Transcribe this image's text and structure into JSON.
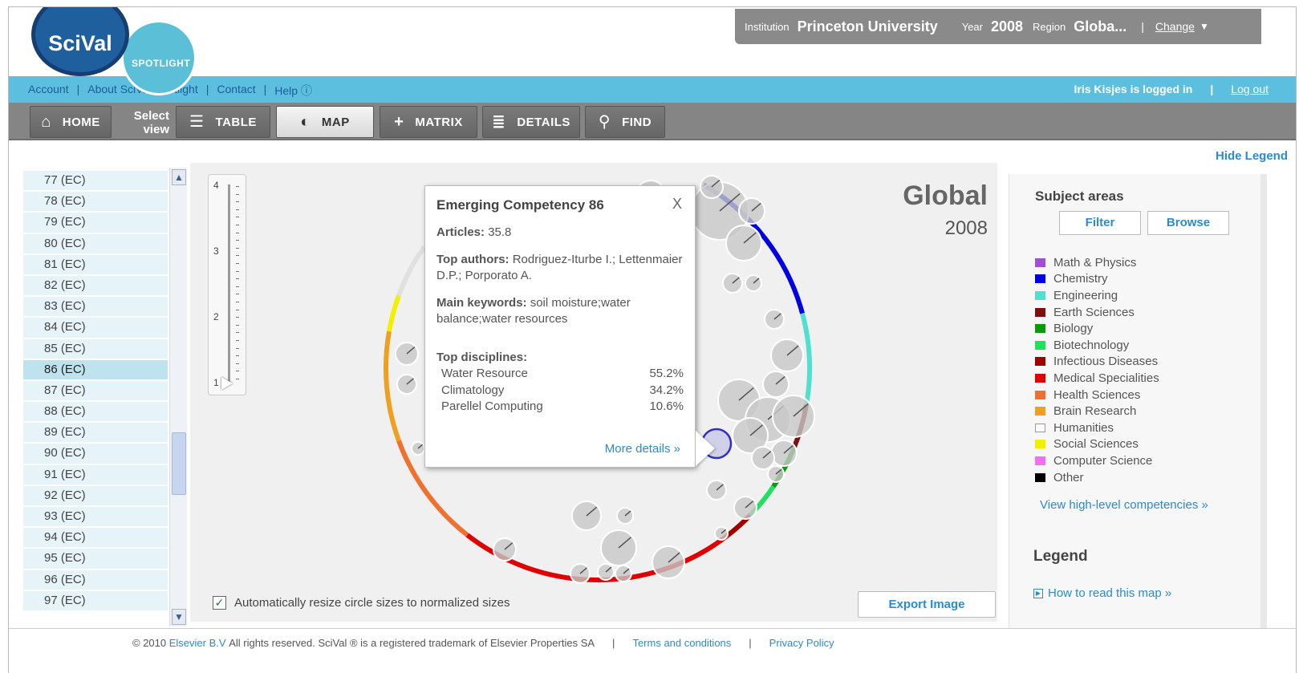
{
  "logo": {
    "main": "SciVal",
    "sub": "SPOTLIGHT"
  },
  "institution_bar": {
    "institution_label": "Institution",
    "institution": "Princeton University",
    "year_label": "Year",
    "year": "2008",
    "region_label": "Region",
    "region": "Globa...",
    "change": "Change"
  },
  "top_links": [
    "Account",
    "About SciVal Spotlight",
    "Contact",
    "Help ⓘ"
  ],
  "user": {
    "status": "Iris Kisjes is logged in",
    "logout": "Log out"
  },
  "toolbar": {
    "home": "HOME",
    "select_view": "Select view",
    "table": "TABLE",
    "map": "MAP",
    "matrix": "MATRIX",
    "details": "DETAILS",
    "find": "FIND"
  },
  "hide_legend": "Hide Legend",
  "list": {
    "items": [
      "77 (EC)",
      "78 (EC)",
      "79 (EC)",
      "80 (EC)",
      "81 (EC)",
      "82 (EC)",
      "83 (EC)",
      "84 (EC)",
      "85 (EC)",
      "86 (EC)",
      "87 (EC)",
      "88 (EC)",
      "89 (EC)",
      "90 (EC)",
      "91 (EC)",
      "92 (EC)",
      "93 (EC)",
      "94 (EC)",
      "95 (EC)",
      "96 (EC)",
      "97 (EC)"
    ],
    "selected": "86 (EC)"
  },
  "slider": {
    "labels": [
      "4",
      "3",
      "2",
      "1"
    ],
    "value": 1
  },
  "map": {
    "title": "Global",
    "year": "2008"
  },
  "popup": {
    "title": "Emerging Competency 86",
    "close": "X",
    "articles_label": "Articles:",
    "articles_value": "35.8",
    "authors_label": "Top authors:",
    "authors_value": "Rodriguez-Iturbe I.; Lettenmaier D.P.; Porporato A.",
    "keywords_label": "Main keywords:",
    "keywords_value": "soil moisture;water balance;water resources",
    "disciplines_label": "Top disciplines:",
    "disciplines": [
      {
        "name": "Water Resource",
        "pct": "55.2%"
      },
      {
        "name": "Climatology",
        "pct": "34.2%"
      },
      {
        "name": "Parellel Computing",
        "pct": "10.6%"
      }
    ],
    "more": "More details »"
  },
  "resize_label": "Automatically resize circle sizes to normalized sizes",
  "resize_checked": true,
  "export": "Export Image",
  "legend": {
    "subject_title": "Subject areas",
    "filter": "Filter",
    "browse": "Browse",
    "areas": [
      {
        "name": "Math & Physics",
        "color": "#a050d0"
      },
      {
        "name": "Chemistry",
        "color": "#0000e0"
      },
      {
        "name": "Engineering",
        "color": "#50e0d0"
      },
      {
        "name": "Earth Sciences",
        "color": "#7a1010"
      },
      {
        "name": "Biology",
        "color": "#0a9a0a"
      },
      {
        "name": "Biotechnology",
        "color": "#20e060"
      },
      {
        "name": "Infectious Diseases",
        "color": "#a00000"
      },
      {
        "name": "Medical Specialities",
        "color": "#e00000"
      },
      {
        "name": "Health Sciences",
        "color": "#f07030"
      },
      {
        "name": "Brain Research",
        "color": "#f0a020"
      },
      {
        "name": "Humanities",
        "color": "#ffffff"
      },
      {
        "name": "Social Sciences",
        "color": "#f0f000"
      },
      {
        "name": "Computer Science",
        "color": "#f070f0"
      },
      {
        "name": "Other",
        "color": "#000000"
      }
    ],
    "view_high": "View high-level competencies »",
    "legend_title": "Legend",
    "how_to": "How to read this map »"
  },
  "footer": {
    "copyright_prefix": "© 2010",
    "company": "Elsevier B.V",
    "copyright_rest": "All rights reserved. SciVal ® is a registered trademark of Elsevier Properties SA",
    "terms": "Terms and conditions",
    "privacy": "Privacy Policy"
  }
}
